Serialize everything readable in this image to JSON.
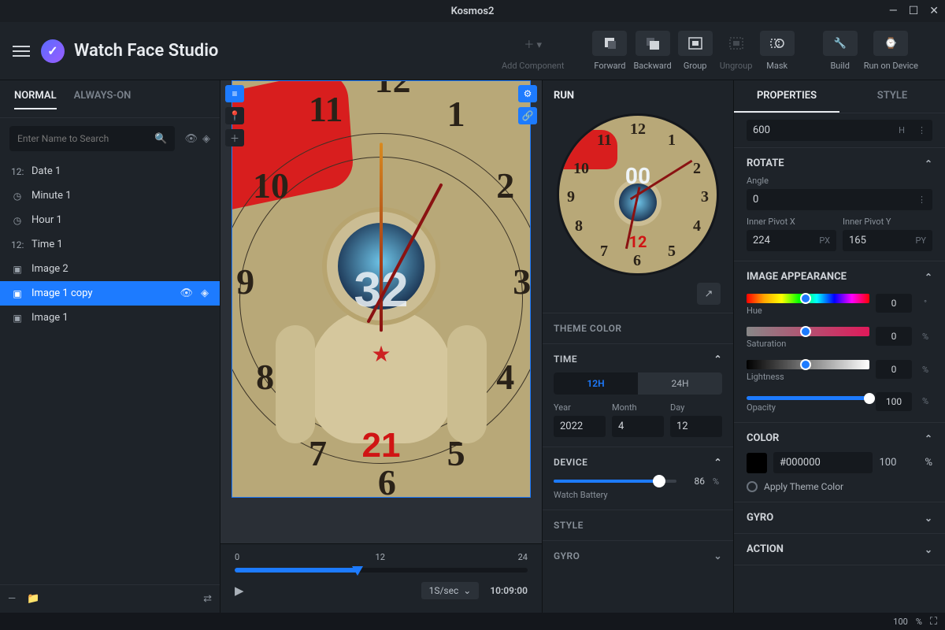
{
  "window": {
    "title": "Kosmos2"
  },
  "app": {
    "name": "Watch Face Studio"
  },
  "toolbar": {
    "add_component": "Add Component",
    "forward": "Forward",
    "backward": "Backward",
    "group": "Group",
    "ungroup": "Ungroup",
    "mask": "Mask",
    "build": "Build",
    "run_on_device": "Run on Device"
  },
  "layers": {
    "tabs": {
      "normal": "NORMAL",
      "always_on": "ALWAYS-ON"
    },
    "search_placeholder": "Enter Name to Search",
    "items": [
      {
        "icon": "12:",
        "label": "Date 1"
      },
      {
        "icon": "clock",
        "label": "Minute 1"
      },
      {
        "icon": "clock",
        "label": "Hour 1"
      },
      {
        "icon": "12:",
        "label": "Time 1"
      },
      {
        "icon": "image",
        "label": "Image 2"
      },
      {
        "icon": "image",
        "label": "Image 1 copy",
        "selected": true
      },
      {
        "icon": "image",
        "label": "Image 1"
      }
    ]
  },
  "canvas": {
    "face_number": "32",
    "bottom_number": "21"
  },
  "timeline": {
    "start": "0",
    "mid": "12",
    "end": "24",
    "speed": "1S/sec",
    "time": "10:09:00"
  },
  "preview": {
    "title": "RUN",
    "face_number": "00",
    "bottom_number": "12",
    "theme_color": "THEME COLOR",
    "time": {
      "title": "TIME",
      "mode_12": "12H",
      "mode_24": "24H",
      "year_label": "Year",
      "year": "2022",
      "month_label": "Month",
      "month": "4",
      "day_label": "Day",
      "day": "12"
    },
    "device": {
      "title": "DEVICE",
      "battery": "86",
      "battery_unit": "%",
      "battery_label": "Watch Battery"
    },
    "style": "STYLE",
    "gyro": "GYRO"
  },
  "props": {
    "tabs": {
      "properties": "PROPERTIES",
      "style": "STYLE"
    },
    "h_value": "600",
    "h_suffix": "H",
    "rotate": {
      "title": "ROTATE",
      "angle_label": "Angle",
      "angle": "0",
      "pivot_x_label": "Inner Pivot X",
      "pivot_x": "224",
      "pivot_x_unit": "PX",
      "pivot_y_label": "Inner Pivot Y",
      "pivot_y": "165",
      "pivot_y_unit": "PY"
    },
    "appearance": {
      "title": "IMAGE APPEARANCE",
      "hue": "0",
      "hue_unit": "°",
      "hue_label": "Hue",
      "sat": "0",
      "sat_unit": "%",
      "sat_label": "Saturation",
      "light": "0",
      "light_unit": "%",
      "light_label": "Lightness",
      "opacity": "100",
      "opacity_unit": "%",
      "opacity_label": "Opacity"
    },
    "color": {
      "title": "COLOR",
      "hex": "#000000",
      "alpha": "100",
      "alpha_unit": "%",
      "apply_theme": "Apply Theme Color"
    },
    "gyro": "GYRO",
    "action": "ACTION"
  },
  "status": {
    "zoom": "100",
    "zoom_unit": "%"
  }
}
